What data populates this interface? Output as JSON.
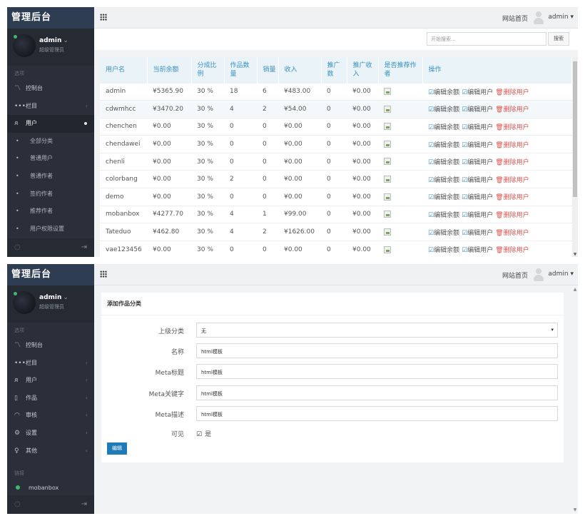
{
  "brand": "管理后台",
  "profile": {
    "name": "admin",
    "role": "超级管理员"
  },
  "topbar": {
    "site_link": "网站首页",
    "user": "admin"
  },
  "sidebar1": {
    "section": "选项",
    "items": [
      {
        "label": "控制台",
        "icon": "chart-line-icon"
      },
      {
        "label": "栏目",
        "icon": "dots-icon"
      },
      {
        "label": "用户",
        "icon": "user-icon"
      }
    ],
    "subitems": [
      "全部分类",
      "普通用户",
      "普通作者",
      "签约作者",
      "推荐作者",
      "用户权限设置"
    ]
  },
  "search": {
    "placeholder": "开始搜索...",
    "button": "搜索"
  },
  "table": {
    "headers": [
      "用户名",
      "当前余额",
      "分成比例",
      "作品数量",
      "销量",
      "收入",
      "推广数",
      "推广收入",
      "是否推荐作者",
      "操作"
    ],
    "actions": {
      "edit_balance": "编辑余额",
      "edit_user": "编辑用户",
      "delete_user": "删除用户"
    },
    "rows": [
      [
        "admin",
        "¥5365.90",
        "30 %",
        "18",
        "6",
        "¥483.00",
        "0",
        "¥0.00"
      ],
      [
        "cdwmhcc",
        "¥3470.20",
        "30 %",
        "4",
        "2",
        "¥54.00",
        "0",
        "¥0.00"
      ],
      [
        "chenchen",
        "¥0.00",
        "30 %",
        "0",
        "0",
        "¥0.00",
        "0",
        "¥0.00"
      ],
      [
        "chendawei",
        "¥0.00",
        "30 %",
        "0",
        "0",
        "¥0.00",
        "0",
        "¥0.00"
      ],
      [
        "chenli",
        "¥0.00",
        "30 %",
        "0",
        "0",
        "¥0.00",
        "0",
        "¥0.00"
      ],
      [
        "colorbang",
        "¥0.00",
        "30 %",
        "2",
        "0",
        "¥0.00",
        "0",
        "¥0.00"
      ],
      [
        "demo",
        "¥0.00",
        "30 %",
        "0",
        "0",
        "¥0.00",
        "0",
        "¥0.00"
      ],
      [
        "mobanbox",
        "¥4277.70",
        "30 %",
        "4",
        "1",
        "¥99.00",
        "0",
        "¥0.00"
      ],
      [
        "Tateduo",
        "¥462.80",
        "30 %",
        "4",
        "2",
        "¥1626.00",
        "0",
        "¥0.00"
      ],
      [
        "vae123456",
        "¥0.00",
        "30 %",
        "0",
        "0",
        "¥0.00",
        "0",
        "¥0.00"
      ]
    ]
  },
  "sidebar2": {
    "section": "选项",
    "items": [
      {
        "label": "控制台",
        "icon": "chart-line-icon"
      },
      {
        "label": "栏目",
        "icon": "dots-icon"
      },
      {
        "label": "用户",
        "icon": "user-icon"
      },
      {
        "label": "作品",
        "icon": "works-icon"
      },
      {
        "label": "审核",
        "icon": "review-icon"
      },
      {
        "label": "设置",
        "icon": "settings-icon"
      },
      {
        "label": "其他",
        "icon": "bulb-icon"
      }
    ],
    "links_section": "链接",
    "link": "mobanbox"
  },
  "form": {
    "title": "添加作品分类",
    "fields": [
      {
        "label": "上级分类",
        "value": "无"
      },
      {
        "label": "名称",
        "value": "html模板"
      },
      {
        "label": "Meta标题",
        "value": "html模板"
      },
      {
        "label": "Meta关键字",
        "value": "html模板"
      },
      {
        "label": "Meta描述",
        "value": "html模板"
      }
    ],
    "visible_label": "可见",
    "visible_value": "是",
    "submit": "编辑"
  }
}
